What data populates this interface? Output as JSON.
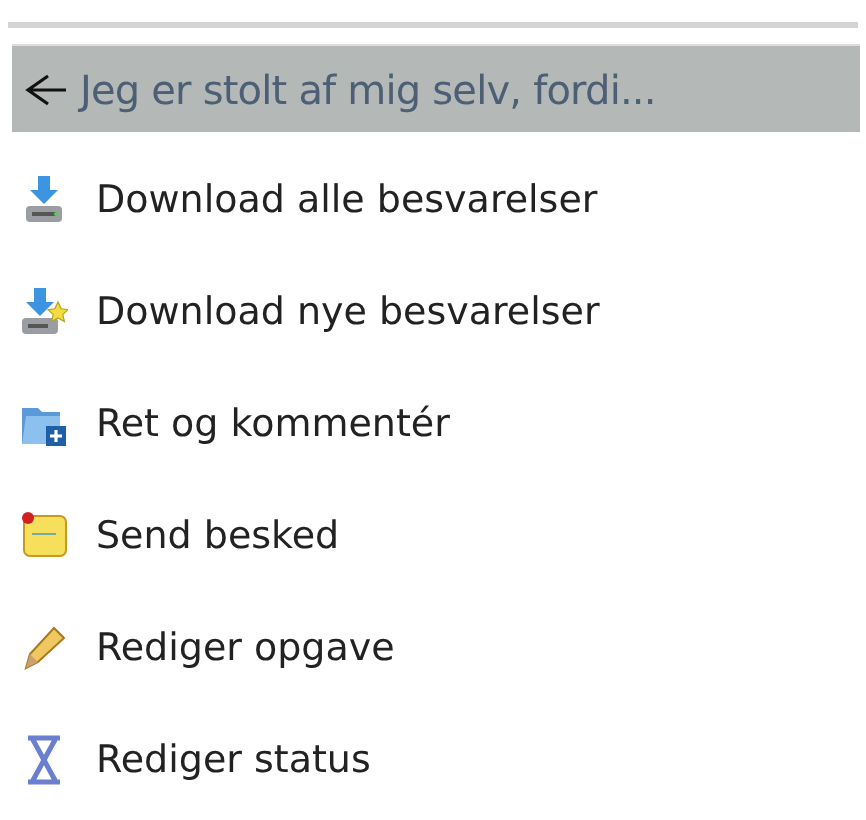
{
  "header": {
    "title": "Jeg er stolt af mig selv, fordi..."
  },
  "menu": [
    {
      "label": "Download alle besvarelser",
      "kind": "download"
    },
    {
      "label": "Download nye besvarelser",
      "kind": "download-new"
    },
    {
      "label": "Ret og kommentér",
      "kind": "folder-add"
    },
    {
      "label": "Send besked",
      "kind": "note"
    },
    {
      "label": "Rediger opgave",
      "kind": "pencil"
    },
    {
      "label": "Rediger status",
      "kind": "hourglass"
    }
  ]
}
